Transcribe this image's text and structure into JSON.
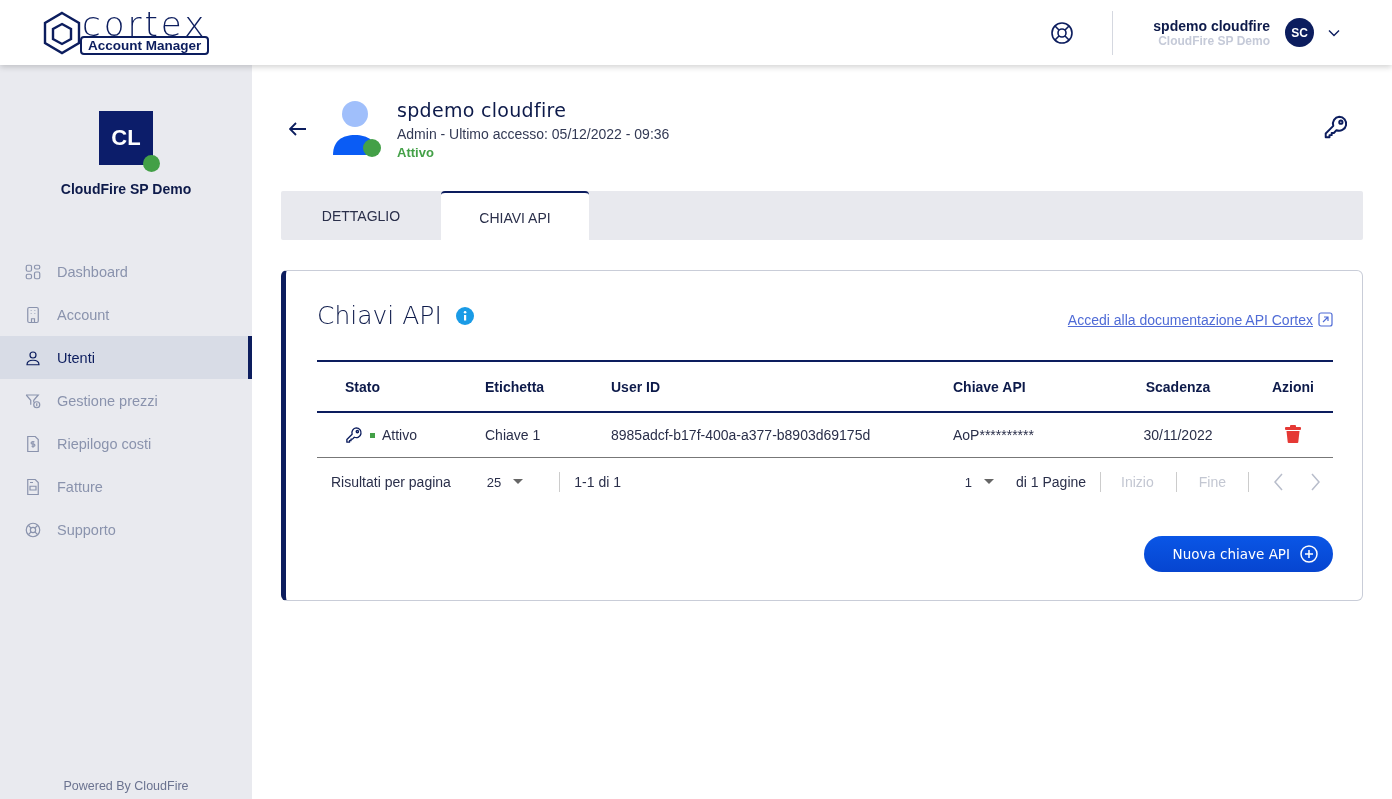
{
  "header": {
    "logo": {
      "wordmark": "cortex",
      "subtitle": "Account Manager"
    },
    "user": {
      "name": "spdemo cloudfire",
      "company": "CloudFire SP Demo",
      "initials": "SC"
    }
  },
  "sidebar": {
    "account": {
      "initials": "CL",
      "name": "CloudFire SP Demo",
      "online": true
    },
    "items": [
      {
        "label": "Dashboard",
        "selected": false
      },
      {
        "label": "Account",
        "selected": false
      },
      {
        "label": "Utenti",
        "selected": true
      },
      {
        "label": "Gestione prezzi",
        "selected": false
      },
      {
        "label": "Riepilogo costi",
        "selected": false
      },
      {
        "label": "Fatture",
        "selected": false
      },
      {
        "label": "Supporto",
        "selected": false
      }
    ],
    "footer": "Powered By CloudFire"
  },
  "profile": {
    "name": "spdemo cloudfire",
    "details": "Admin - Ultimo accesso: 05/12/2022 - 09:36",
    "status": "Attivo",
    "online": true
  },
  "tabs": [
    {
      "label": "DETTAGLIO",
      "selected": false
    },
    {
      "label": "CHIAVI API",
      "selected": true
    }
  ],
  "keys_card": {
    "title": "Chiavi API",
    "doc_link": "Accedi alla documentazione API Cortex",
    "table": {
      "columns": [
        "Stato",
        "Etichetta",
        "User ID",
        "Chiave API",
        "Scadenza",
        "Azioni"
      ],
      "rows": [
        {
          "status": "Attivo",
          "active": true,
          "label": "Chiave 1",
          "user_id": "8985adcf-b17f-400a-a377-b8903d69175d",
          "api_key": "AoP**********",
          "expiry": "30/11/2022"
        }
      ]
    },
    "pagination": {
      "per_page_label": "Risultati per pagina",
      "per_page": "25",
      "range": "1-1 di 1",
      "page": "1",
      "pages": "di 1 Pagine",
      "first": {
        "label": "Inizio",
        "disabled": true
      },
      "last": {
        "label": "Fine",
        "disabled": true
      },
      "prev": {
        "disabled": true
      },
      "next": {
        "disabled": true
      }
    },
    "new_button": "Nuova chiave API"
  }
}
